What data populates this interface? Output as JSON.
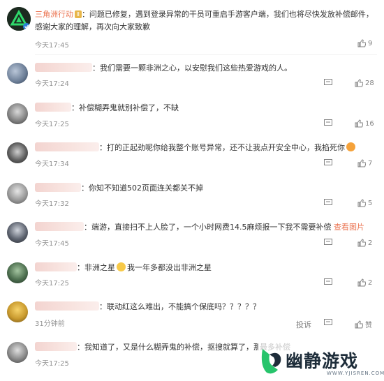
{
  "comments": [
    {
      "author": "三角洲行动",
      "badge": "Ⅱ",
      "text": "：问题已修复，遇到登录异常的干员可重启手游客户端，我们也将尽快发放补偿邮件，感谢大家的理解，再次向大家致歉",
      "time": "今天17:45",
      "likes": "9"
    },
    {
      "text": "：我们需要一颗非洲之心，以安慰我们这些热爱游戏的人。",
      "time": "今天17:24",
      "likes": "28"
    },
    {
      "text": "：补偿糊弄鬼就别补偿了，不缺",
      "time": "今天17:25",
      "likes": "16"
    },
    {
      "text": "：打的正起劲呢你给我整个账号异常，还不让我点开安全中心，我掐死你",
      "time": "今天17:34",
      "likes": "7"
    },
    {
      "text": "：你知不知道502页面连关都关不掉",
      "time": "今天17:32",
      "likes": "5"
    },
    {
      "text": "：端游，直接扫不上人脸了，一个小时网费14.5麻烦报一下我不需要补偿",
      "link": "查看图片",
      "time": "今天17:45",
      "likes": "2"
    },
    {
      "text": "：非洲之星",
      "text2": "我一年多都没出非洲之星",
      "time": "今天17:25",
      "likes": "2"
    },
    {
      "text": "：联动红这么难出，不能搞个保底吗？？？？？",
      "time": "31分钟前",
      "report": "投诉",
      "likes": "赞"
    },
    {
      "text": "：我知道了，又是什么糊弄鬼的补偿，抠搜就算了，那",
      "text_tail": "最多补偿",
      "time": "今天17:25"
    }
  ],
  "watermark": {
    "brand": "幽静游戏",
    "url": "WWW.YJISREN.COM"
  },
  "colors": {
    "accent": "#eb7350",
    "time": "#939393",
    "text": "#333333"
  },
  "icons": {
    "like": "thumb-up-icon",
    "comment": "comment-icon",
    "share": "share-icon"
  }
}
